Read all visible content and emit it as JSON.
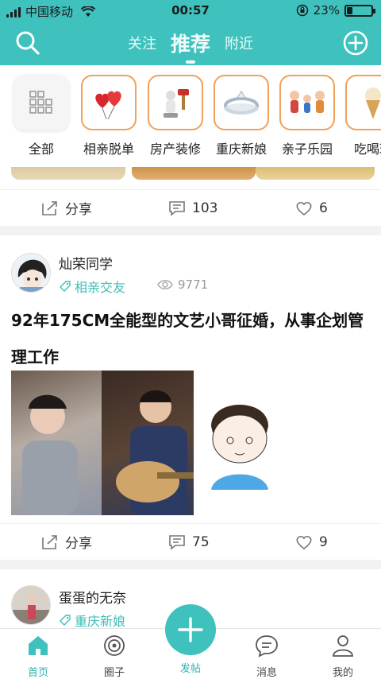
{
  "status_bar": {
    "carrier": "中国移动",
    "time": "00:57",
    "battery": "23%",
    "battery_level": 0.23
  },
  "header": {
    "tabs": [
      "关注",
      "推荐",
      "附近"
    ],
    "active_tab": "推荐"
  },
  "categories": [
    {
      "label": "全部",
      "icon": "grid-icon"
    },
    {
      "label": "相亲脱单",
      "icon": "hearts-balloon-icon"
    },
    {
      "label": "房产装修",
      "icon": "paint-brush-icon"
    },
    {
      "label": "重庆新娘",
      "icon": "ring-icon"
    },
    {
      "label": "亲子乐园",
      "icon": "family-icon"
    },
    {
      "label": "吃喝玩",
      "icon": "ice-cream-icon"
    }
  ],
  "post_prev": {
    "share": "分享",
    "comments": "103",
    "likes": "6"
  },
  "post1": {
    "author": "灿荣同学",
    "tag": "相亲交友",
    "views": "9771",
    "title_line1": "92年175CM全能型的文艺小哥征婚，从事企划管",
    "title_line2": "理工作",
    "share": "分享",
    "comments": "75",
    "likes": "9"
  },
  "post2": {
    "author": "蛋蛋的无奈",
    "tag": "重庆新娘"
  },
  "tabbar": {
    "home": "首页",
    "circle": "圈子",
    "post": "发帖",
    "message": "消息",
    "mine": "我的"
  },
  "colors": {
    "accent": "#3fc1be",
    "tag": "#3fbdb8",
    "category_border": "#f0a15a"
  }
}
